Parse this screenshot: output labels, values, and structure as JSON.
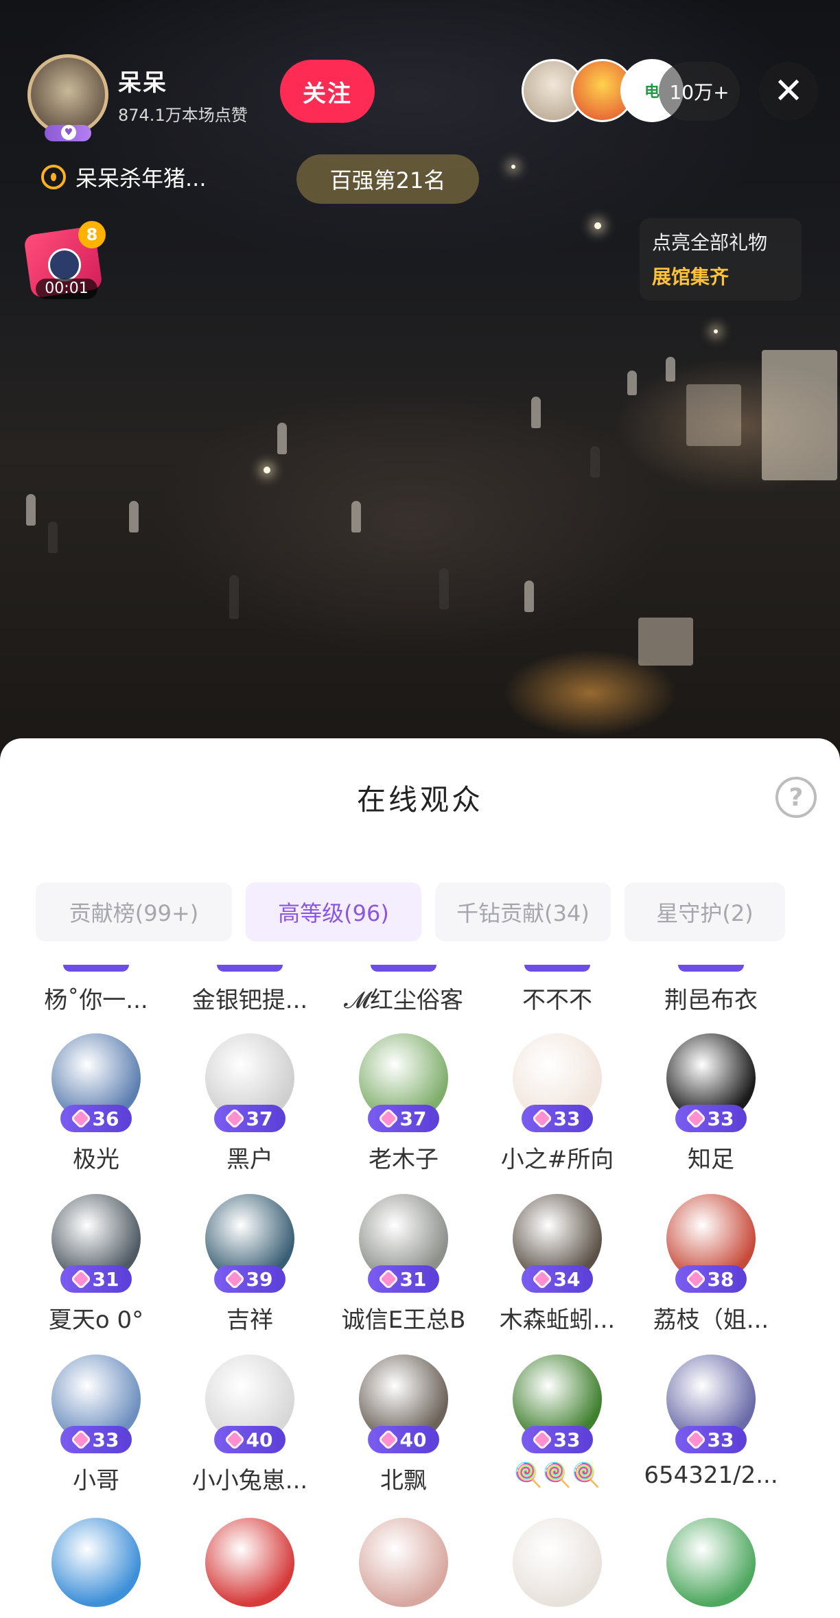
{
  "host": {
    "name": "呆呆",
    "likes": "874.1万本场点赞",
    "follow_label": "关注",
    "fan_group": "呆呆杀年猪...",
    "rank": "百强第21名"
  },
  "viewer_strip": {
    "count": "10万+",
    "close_icon": "✕"
  },
  "gift_timer": {
    "badge": "8",
    "time": "00:01"
  },
  "gallery_card": {
    "line1": "点亮全部礼物",
    "line2": "展馆集齐"
  },
  "sheet": {
    "title": "在线观众",
    "help_icon": "?",
    "tabs": [
      {
        "label": "贡献榜(99+)",
        "active": false
      },
      {
        "label": "高等级(96)",
        "active": true
      },
      {
        "label": "千钻贡献(34)",
        "active": false
      },
      {
        "label": "星守护(2)",
        "active": false
      }
    ],
    "cut_row": [
      {
        "name": "杨˚你一..."
      },
      {
        "name": "金银钯提..."
      },
      {
        "name": "𝓜红尘俗客"
      },
      {
        "name": "不不不"
      },
      {
        "name": "荆邑布衣"
      }
    ],
    "rows": [
      [
        {
          "name": "极光",
          "level": "36",
          "color": "#5d7fb0"
        },
        {
          "name": "黑户",
          "level": "37",
          "color": "#cfcfcf"
        },
        {
          "name": "老木子",
          "level": "37",
          "color": "#7fae6c"
        },
        {
          "name": "小之#所向",
          "level": "33",
          "color": "#f1e5dc"
        },
        {
          "name": "知足",
          "level": "33",
          "color": "#1b1b1b"
        }
      ],
      [
        {
          "name": "夏天o 0°",
          "level": "31",
          "color": "#4f5a63"
        },
        {
          "name": "吉祥",
          "level": "39",
          "color": "#3a5f74"
        },
        {
          "name": "诚信E王总B",
          "level": "31",
          "color": "#8c8f8a"
        },
        {
          "name": "木森蚯蚓...",
          "level": "34",
          "color": "#5c5248"
        },
        {
          "name": "荔枝（姐...",
          "level": "38",
          "color": "#c74a3a"
        }
      ],
      [
        {
          "name": "小哥",
          "level": "33",
          "color": "#6d8fbf"
        },
        {
          "name": "小小兔崽...",
          "level": "40",
          "color": "#d8d8d8"
        },
        {
          "name": "北飘",
          "level": "40",
          "color": "#6b6259"
        },
        {
          "name": "🍭🍭🍭",
          "level": "33",
          "color": "#3f7f2e"
        },
        {
          "name": "654321/2...",
          "level": "33",
          "color": "#6a6aa8"
        }
      ]
    ],
    "partial_row": [
      {
        "color": "#3d8fd8"
      },
      {
        "color": "#d63a3a"
      },
      {
        "color": "#d8a8a0"
      },
      {
        "color": "#e8e2dc"
      },
      {
        "color": "#4fa860"
      }
    ]
  }
}
